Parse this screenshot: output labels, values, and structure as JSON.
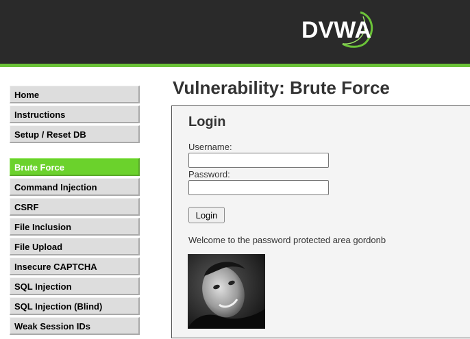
{
  "header": {
    "logo_text": "DVWA"
  },
  "menu": {
    "group1": [
      "Home",
      "Instructions",
      "Setup / Reset DB"
    ],
    "group2": [
      "Brute Force",
      "Command Injection",
      "CSRF",
      "File Inclusion",
      "File Upload",
      "Insecure CAPTCHA",
      "SQL Injection",
      "SQL Injection (Blind)",
      "Weak Session IDs"
    ],
    "selected": "Brute Force"
  },
  "main": {
    "title": "Vulnerability: Brute Force",
    "login": {
      "heading": "Login",
      "username_label": "Username:",
      "username_value": "",
      "password_label": "Password:",
      "password_value": "",
      "button_label": "Login",
      "welcome_text": "Welcome to the password protected area gordonb"
    }
  },
  "colors": {
    "accent": "#6bd22c",
    "header_bg": "#2a2a2a",
    "header_line": "#6bc238"
  }
}
